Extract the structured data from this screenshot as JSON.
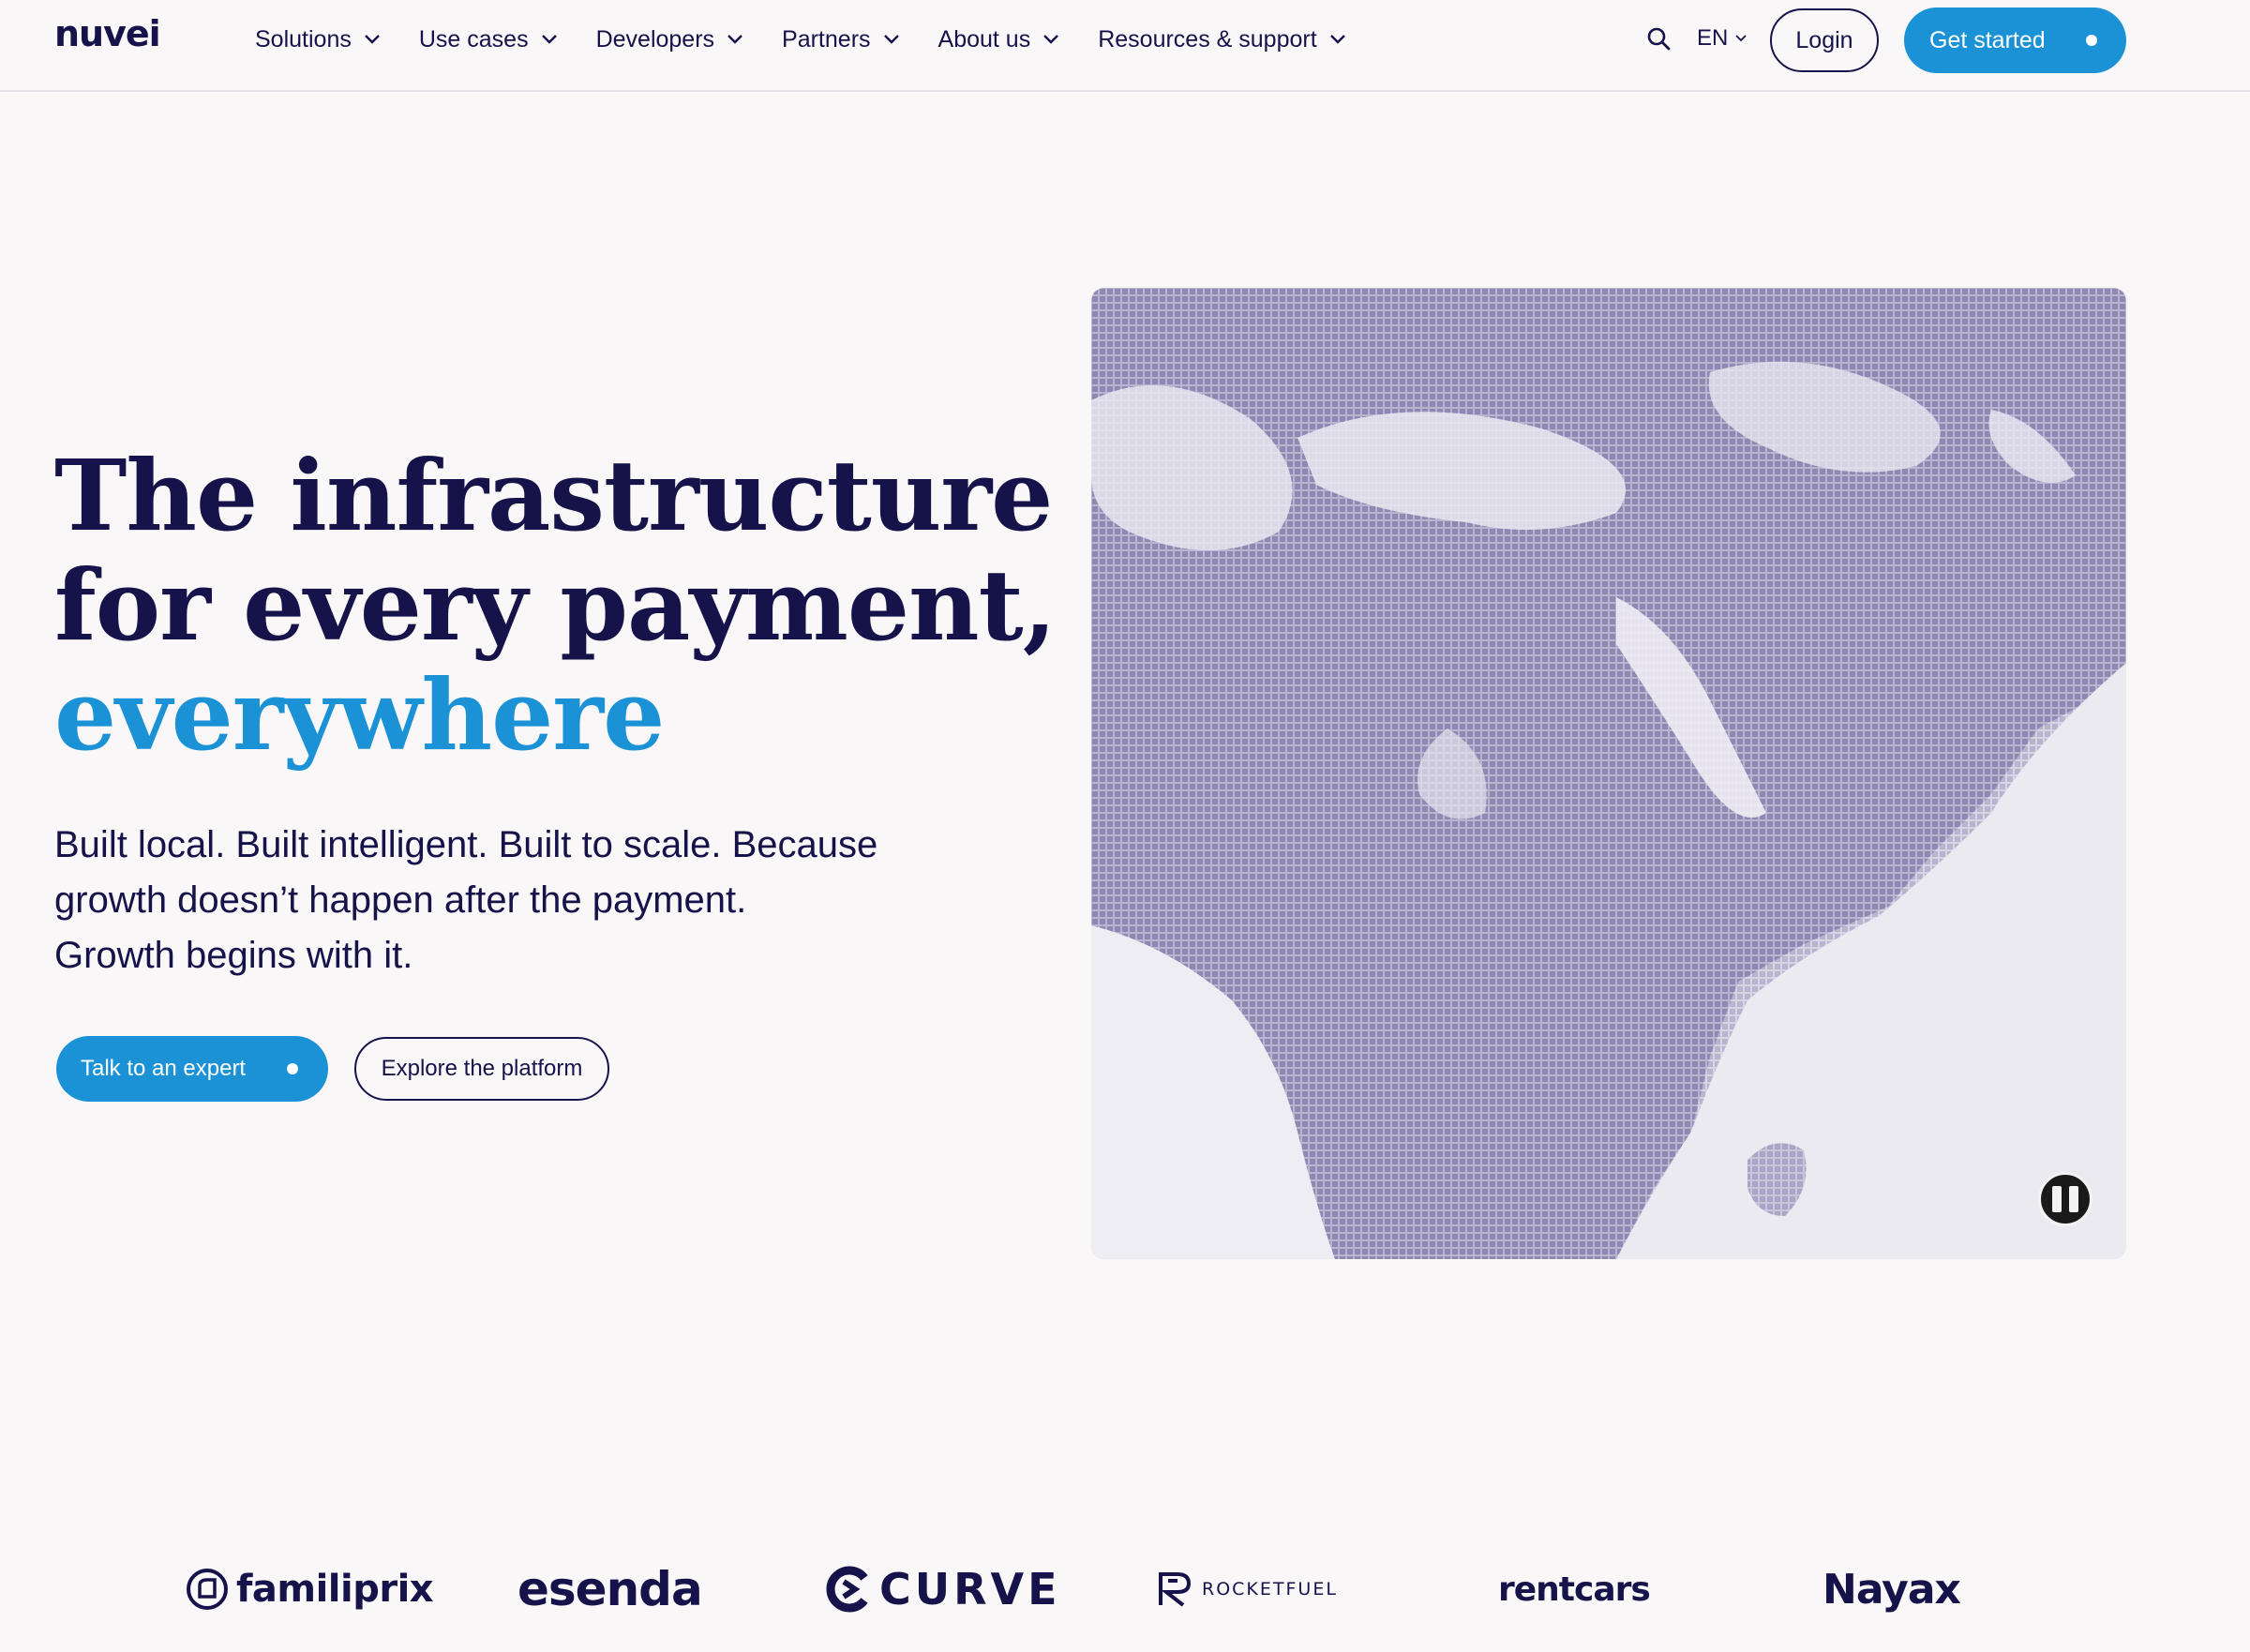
{
  "header": {
    "logo": "nuvei",
    "nav": [
      "Solutions",
      "Use cases",
      "Developers",
      "Partners",
      "About us",
      "Resources & support"
    ],
    "language": "EN",
    "login_label": "Login",
    "get_started_label": "Get started"
  },
  "hero": {
    "title_lines": [
      "The infrastructure",
      "for every payment,"
    ],
    "title_accent": "everywhere",
    "subtitle_lines": [
      "Built local. Built intelligent. Built to scale. Because",
      "growth doesn’t happen after the payment.",
      "Growth begins with it."
    ],
    "primary_cta": "Talk to an expert",
    "secondary_cta": "Explore the platform",
    "media": {
      "kind": "looping map video",
      "state": "playing",
      "control_icon": "pause-icon"
    }
  },
  "logos": [
    "familiprix",
    "esenda",
    "CURVE",
    "ROCKETFUEL",
    "rentcars",
    "Nayax"
  ],
  "colors": {
    "navy": "#16134b",
    "accent": "#1b92d6",
    "background": "#f9f7f7",
    "map_land": "#9590b7",
    "map_water": "#ecebf1"
  }
}
